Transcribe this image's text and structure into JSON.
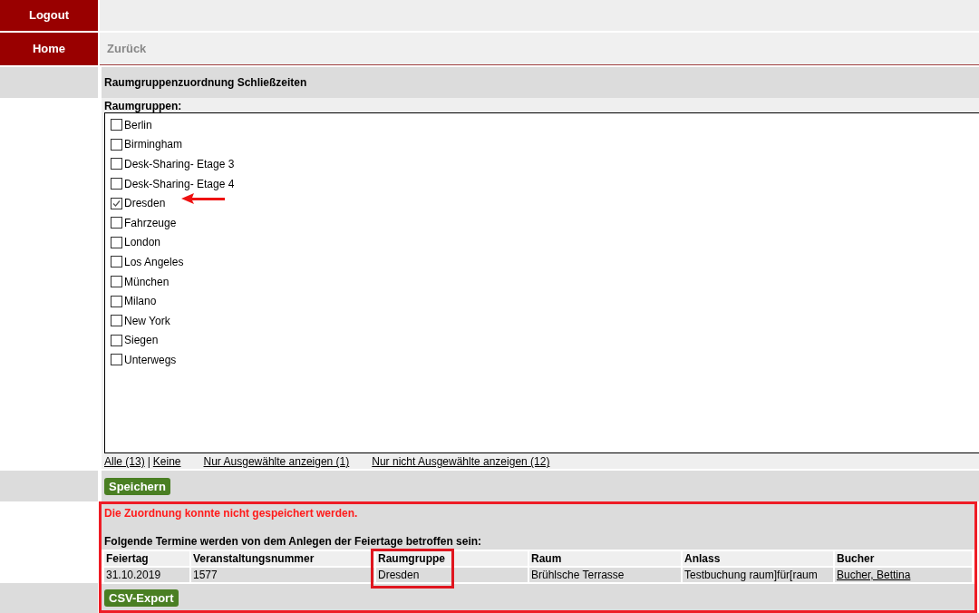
{
  "nav": {
    "logout": "Logout",
    "home": "Home",
    "back": "Zurück"
  },
  "page_title": "Raumgruppenzuordnung Schließzeiten",
  "group_label": "Raumgruppen:",
  "groups": [
    {
      "label": "Berlin",
      "checked": false
    },
    {
      "label": "Birmingham",
      "checked": false
    },
    {
      "label": "Desk-Sharing- Etage 3",
      "checked": false
    },
    {
      "label": "Desk-Sharing- Etage 4",
      "checked": false
    },
    {
      "label": "Dresden",
      "checked": true
    },
    {
      "label": "Fahrzeuge",
      "checked": false
    },
    {
      "label": "London",
      "checked": false
    },
    {
      "label": "Los Angeles",
      "checked": false
    },
    {
      "label": "München",
      "checked": false
    },
    {
      "label": "Milano",
      "checked": false
    },
    {
      "label": "New York",
      "checked": false
    },
    {
      "label": "Siegen",
      "checked": false
    },
    {
      "label": "Unterwegs",
      "checked": false
    }
  ],
  "filter_links": {
    "all": "Alle (13)",
    "separator": "|",
    "none": "Keine",
    "only_selected": "Nur Ausgewählte anzeigen (1)",
    "only_unselected": "Nur nicht Ausgewählte anzeigen (12)"
  },
  "save_button": "Speichern",
  "error": {
    "message": "Die Zuordnung konnte nicht gespeichert werden.",
    "intro": "Folgende Termine werden von dem Anlegen der Feiertage betroffen sein:",
    "columns": [
      "Feiertag",
      "Veranstaltungsnummer",
      "Raumgruppe",
      "Raum",
      "Anlass",
      "Bucher"
    ],
    "rows": [
      [
        {
          "kind": "text",
          "text": "31.10.2019"
        },
        {
          "kind": "text",
          "text": "1577"
        },
        {
          "kind": "text",
          "text": "Dresden"
        },
        {
          "kind": "text",
          "text": "Brühlsche Terrasse"
        },
        {
          "kind": "text",
          "text": "Testbuchung raum]für[raum"
        },
        {
          "kind": "link",
          "text": "Bucher, Bettina"
        }
      ]
    ],
    "export_button": "CSV-Export"
  }
}
